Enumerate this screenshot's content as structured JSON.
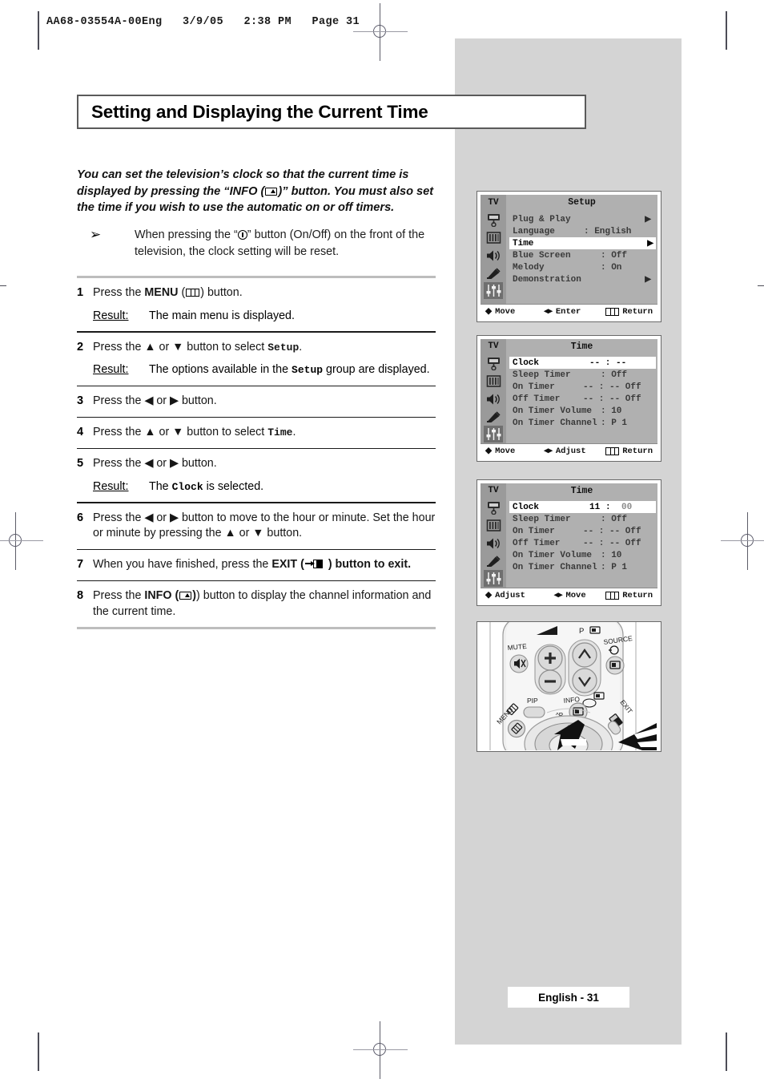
{
  "header": {
    "line": "AA68-03554A-00Eng   3/9/05   2:38 PM   Page 31"
  },
  "title": "Setting and Displaying the Current Time",
  "intro": {
    "part1": "You can set the television’s clock so that the current time is displayed by pressing the “INFO (",
    "part2": ")” button. You must also set the time if you wish to use the automatic on or off timers."
  },
  "note": {
    "bullet": "➢",
    "part1": "When pressing the “",
    "part2": "” button (On/Off) on the front of the television, the clock setting will be reset."
  },
  "steps": [
    {
      "num": "1",
      "text_a": "Press the ",
      "bold": "MENU",
      "text_b": " (",
      "text_c": ") button.",
      "result_label": "Result:",
      "result_text": "The main menu is displayed."
    },
    {
      "num": "2",
      "text_a": "Press the ▲ or ▼ button to select ",
      "mono": "Setup",
      "text_b": ".",
      "result_label": "Result:",
      "result_a": "The options available in the ",
      "result_mono": "Setup",
      "result_b": " group are displayed."
    },
    {
      "num": "3",
      "text_a": "Press the ◀ or ▶ button."
    },
    {
      "num": "4",
      "text_a": "Press the ▲ or ▼ button to select ",
      "mono": "Time",
      "text_b": "."
    },
    {
      "num": "5",
      "text_a": "Press the ◀ or ▶ button.",
      "result_label": "Result:",
      "result_a": "The ",
      "result_mono": "Clock",
      "result_b": " is selected."
    },
    {
      "num": "6",
      "text_a": "Press the ◀ or ▶ button to move to the hour or minute. Set the hour or minute by pressing the ▲ or ▼ button."
    },
    {
      "num": "7",
      "text_a": "When you have finished, press the ",
      "bold": "EXIT (",
      "text_c": " ) button to exit."
    },
    {
      "num": "8",
      "text_a": "Press the ",
      "bold": "INFO (",
      "text_c": ") button to display the channel information and the current time."
    }
  ],
  "osd_panels": [
    {
      "tv": "TV",
      "title": "Setup",
      "selected_rail": 5,
      "rows": [
        {
          "label": "Plug & Play",
          "value": "",
          "arrow": "▶",
          "highlight": false
        },
        {
          "label": "Language",
          "value": ": English",
          "arrow": "",
          "highlight": false
        },
        {
          "label": "Time",
          "value": "",
          "arrow": "▶",
          "highlight": true
        },
        {
          "label": "Blue Screen",
          "value": ": Off",
          "arrow": "",
          "highlight": false
        },
        {
          "label": "Melody",
          "value": ": On",
          "arrow": "",
          "highlight": false
        },
        {
          "label": "Demonstration",
          "value": "",
          "arrow": "▶",
          "highlight": false
        }
      ],
      "footer": {
        "a": "Move",
        "a_icon": "↕",
        "b": "Enter",
        "b_icon": "◀▶",
        "c": "Return",
        "c_icon": "menu"
      }
    },
    {
      "tv": "TV",
      "title": "Time",
      "selected_rail": 5,
      "rows": [
        {
          "label": "Clock",
          "value": "--  :  --",
          "arrow": "",
          "highlight": true
        },
        {
          "label": "Sleep Timer",
          "value": ":  Off",
          "arrow": "",
          "highlight": false
        },
        {
          "label": "On Timer",
          "value": "--  :  --  Off",
          "arrow": "",
          "highlight": false
        },
        {
          "label": "Off Timer",
          "value": "--  :  --  Off",
          "arrow": "",
          "highlight": false
        },
        {
          "label": "On Timer Volume",
          "value": ":   10",
          "arrow": "",
          "highlight": false
        },
        {
          "label": "On Timer Channel",
          "value": ":  P 1",
          "arrow": "",
          "highlight": false
        }
      ],
      "footer": {
        "a": "Move",
        "a_icon": "↕",
        "b": "Adjust",
        "b_icon": "◀▶",
        "c": "Return",
        "c_icon": "menu"
      }
    },
    {
      "tv": "TV",
      "title": "Time",
      "selected_rail": 5,
      "rows": [
        {
          "label": "Clock",
          "value_bold": "11",
          "value_sep": " : ",
          "value_dim": "00",
          "arrow": "",
          "highlight": true
        },
        {
          "label": "Sleep Timer",
          "value": ":  Off",
          "arrow": "",
          "highlight": false
        },
        {
          "label": "On Timer",
          "value": "--  :  --  Off",
          "arrow": "",
          "highlight": false
        },
        {
          "label": "Off Timer",
          "value": "--  :  --  Off",
          "arrow": "",
          "highlight": false
        },
        {
          "label": "On Timer Volume",
          "value": ":   10",
          "arrow": "",
          "highlight": false
        },
        {
          "label": "On Timer Channel",
          "value": ":  P 1",
          "arrow": "",
          "highlight": false
        }
      ],
      "footer": {
        "a": "Adjust",
        "a_icon": "↕",
        "b": "Move",
        "b_icon": "◀▶",
        "c": "Return",
        "c_icon": "menu"
      }
    }
  ],
  "remote": {
    "labels": {
      "mute": "MUTE",
      "p": "P",
      "source": "SOURCE",
      "pip": "PIP",
      "info": "INFO",
      "menu": "MENU",
      "exit": "EXIT",
      "chan": "P"
    }
  },
  "page_footer": "English - 31",
  "colors": {
    "grey_column": "#d4d4d4",
    "osd_background": "#b0b0b0",
    "osd_rail": "#9a9a9a",
    "osd_rail_selected": "#6f6f6f",
    "rule": "#1a1a1a",
    "rule_thick": "#bdbdbd"
  }
}
